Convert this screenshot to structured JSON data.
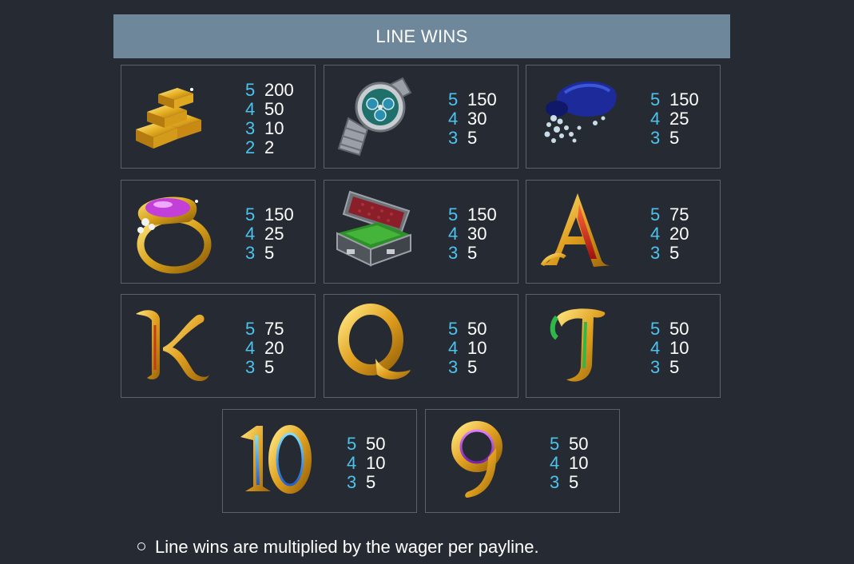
{
  "header": {
    "title": "LINE WINS"
  },
  "colors": {
    "accent": "#4cc3ef",
    "header_bg": "#6f879a",
    "background": "#262b33"
  },
  "cards": [
    {
      "symbol": "gold-bars-icon",
      "pays": [
        {
          "n": "5",
          "v": "200"
        },
        {
          "n": "4",
          "v": "50"
        },
        {
          "n": "3",
          "v": "10"
        },
        {
          "n": "2",
          "v": "2"
        }
      ]
    },
    {
      "symbol": "watch-icon",
      "pays": [
        {
          "n": "5",
          "v": "150"
        },
        {
          "n": "4",
          "v": "30"
        },
        {
          "n": "3",
          "v": "5"
        }
      ]
    },
    {
      "symbol": "diamond-bag-icon",
      "pays": [
        {
          "n": "5",
          "v": "150"
        },
        {
          "n": "4",
          "v": "25"
        },
        {
          "n": "3",
          "v": "5"
        }
      ]
    },
    {
      "symbol": "ring-icon",
      "pays": [
        {
          "n": "5",
          "v": "150"
        },
        {
          "n": "4",
          "v": "25"
        },
        {
          "n": "3",
          "v": "5"
        }
      ]
    },
    {
      "symbol": "cash-case-icon",
      "pays": [
        {
          "n": "5",
          "v": "150"
        },
        {
          "n": "4",
          "v": "30"
        },
        {
          "n": "3",
          "v": "5"
        }
      ]
    },
    {
      "symbol": "letter-a-icon",
      "pays": [
        {
          "n": "5",
          "v": "75"
        },
        {
          "n": "4",
          "v": "20"
        },
        {
          "n": "3",
          "v": "5"
        }
      ]
    },
    {
      "symbol": "letter-k-icon",
      "pays": [
        {
          "n": "5",
          "v": "75"
        },
        {
          "n": "4",
          "v": "20"
        },
        {
          "n": "3",
          "v": "5"
        }
      ]
    },
    {
      "symbol": "letter-q-icon",
      "pays": [
        {
          "n": "5",
          "v": "50"
        },
        {
          "n": "4",
          "v": "10"
        },
        {
          "n": "3",
          "v": "5"
        }
      ]
    },
    {
      "symbol": "letter-j-icon",
      "pays": [
        {
          "n": "5",
          "v": "50"
        },
        {
          "n": "4",
          "v": "10"
        },
        {
          "n": "3",
          "v": "5"
        }
      ]
    },
    {
      "symbol": "number-10-icon",
      "pays": [
        {
          "n": "5",
          "v": "50"
        },
        {
          "n": "4",
          "v": "10"
        },
        {
          "n": "3",
          "v": "5"
        }
      ]
    },
    {
      "symbol": "number-9-icon",
      "pays": [
        {
          "n": "5",
          "v": "50"
        },
        {
          "n": "4",
          "v": "10"
        },
        {
          "n": "3",
          "v": "5"
        }
      ]
    }
  ],
  "note": {
    "text": "Line wins are multiplied by the wager per payline."
  }
}
